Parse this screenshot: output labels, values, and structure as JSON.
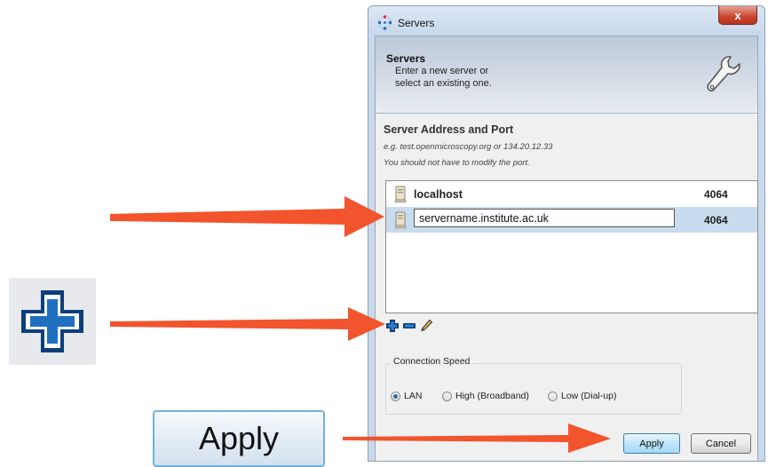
{
  "window": {
    "title": "Servers",
    "close_glyph": "x"
  },
  "banner": {
    "title": "Servers",
    "line1": "Enter a new server or",
    "line2": "select an existing one.",
    "icon": "wrench-icon"
  },
  "section": {
    "title": "Server Address and Port",
    "hint1": "e.g. test.openmicroscopy.org or 134.20.12.33",
    "hint2": "You should not have to modify the port."
  },
  "servers": [
    {
      "host": "localhost",
      "port": "4064"
    },
    {
      "host": "servername.institute.ac.uk",
      "port": "4064",
      "editing": true
    }
  ],
  "tools": {
    "add_icon": "plus-icon",
    "remove_icon": "minus-icon",
    "edit_icon": "pencil-icon"
  },
  "connection_speed": {
    "legend": "Connection Speed",
    "options": [
      "LAN",
      "High (Broadband)",
      "Low (Dial-up)"
    ],
    "selected": "LAN"
  },
  "buttons": {
    "apply": "Apply",
    "cancel": "Cancel"
  },
  "callouts": {
    "apply_zoom_label": "Apply",
    "plus_zoom_icon": "plus-icon"
  },
  "colors": {
    "arrow": "#f2542d",
    "accent": "#1f6fbf",
    "selection": "#c9dcef"
  }
}
